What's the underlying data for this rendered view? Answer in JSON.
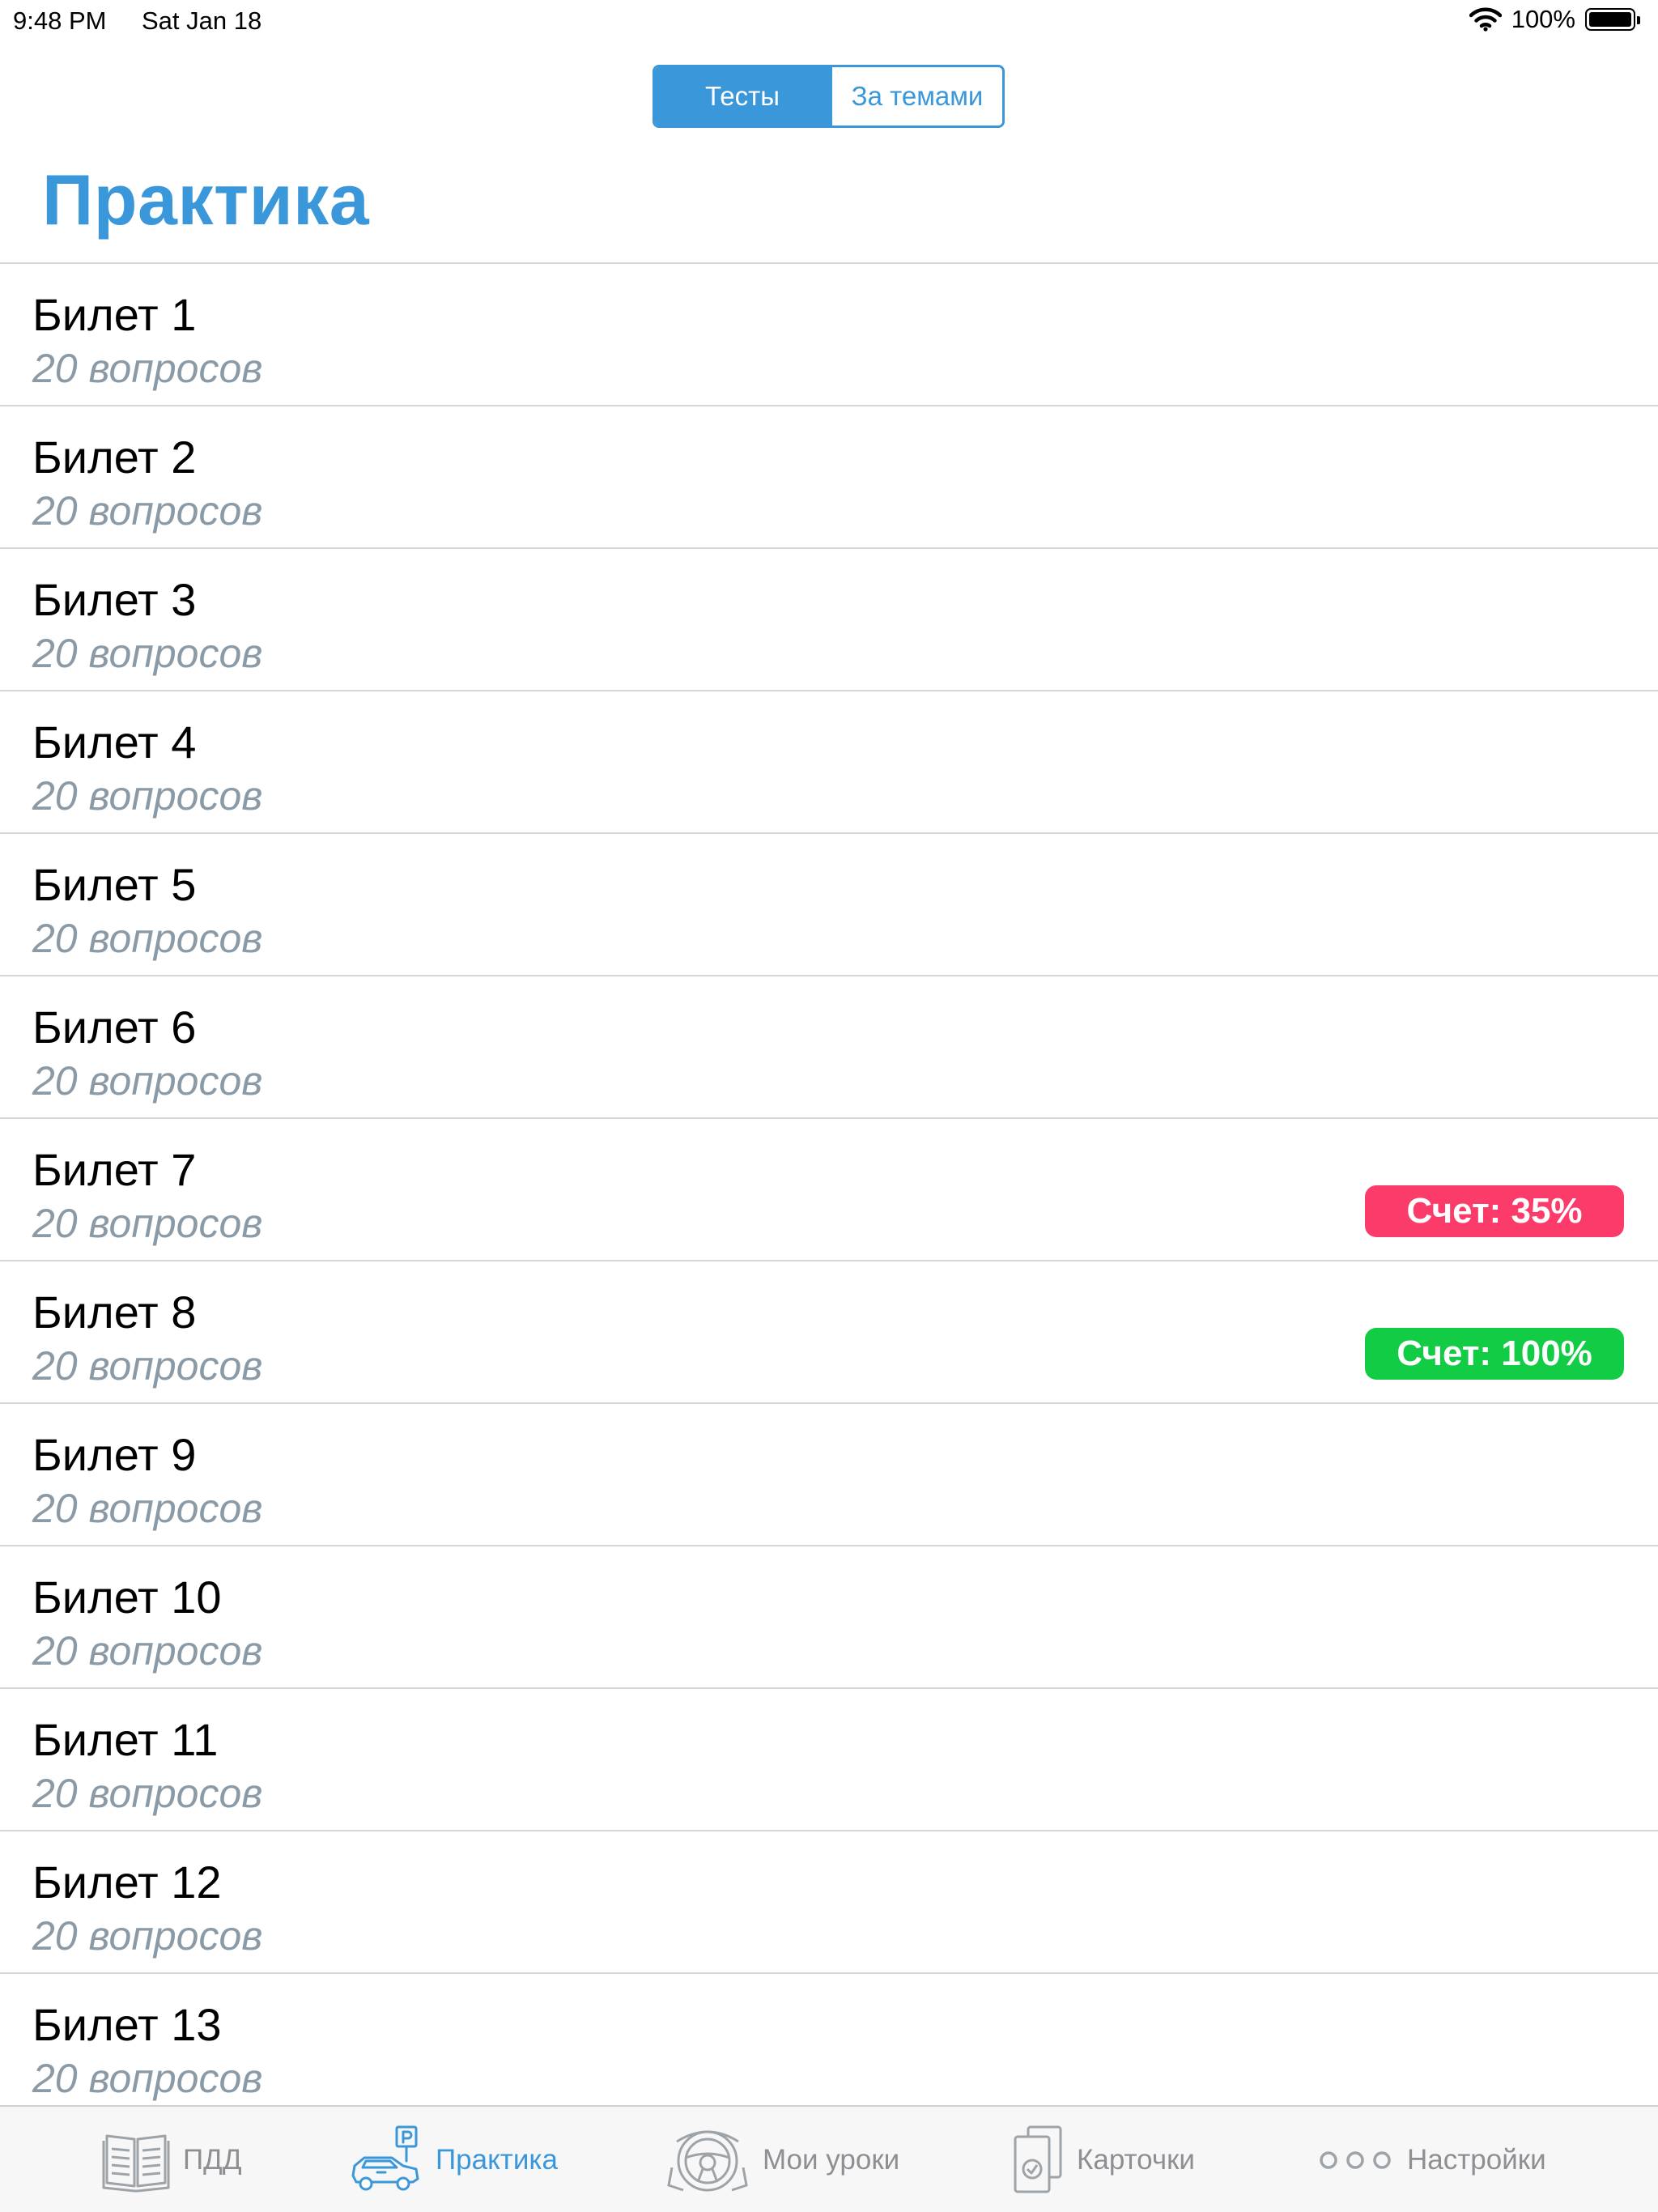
{
  "status": {
    "time": "9:48 PM",
    "date": "Sat Jan 18",
    "battery": "100%"
  },
  "segments": [
    "Тесты",
    "За темами"
  ],
  "title": "Практика",
  "tickets": [
    {
      "title": "Билет 1",
      "subtitle": "20 вопросов"
    },
    {
      "title": "Билет 2",
      "subtitle": "20 вопросов"
    },
    {
      "title": "Билет 3",
      "subtitle": "20 вопросов"
    },
    {
      "title": "Билет 4",
      "subtitle": "20 вопросов"
    },
    {
      "title": "Билет 5",
      "subtitle": "20 вопросов"
    },
    {
      "title": "Билет 6",
      "subtitle": "20 вопросов"
    },
    {
      "title": "Билет 7",
      "subtitle": "20 вопросов",
      "score": "Счет: 35%",
      "score_color": "#fb3c6b"
    },
    {
      "title": "Билет 8",
      "subtitle": "20 вопросов",
      "score": "Счет: 100%",
      "score_color": "#12cc46"
    },
    {
      "title": "Билет 9",
      "subtitle": "20 вопросов"
    },
    {
      "title": "Билет 10",
      "subtitle": "20 вопросов"
    },
    {
      "title": "Билет 11",
      "subtitle": "20 вопросов"
    },
    {
      "title": "Билет 12",
      "subtitle": "20 вопросов"
    },
    {
      "title": "Билет 13",
      "subtitle": "20 вопросов"
    }
  ],
  "tabs": [
    {
      "label": "ПДД",
      "icon": "book-icon"
    },
    {
      "label": "Практика",
      "icon": "car-parking-icon",
      "active": true
    },
    {
      "label": "Мои уроки",
      "icon": "steering-wheel-icon"
    },
    {
      "label": "Карточки",
      "icon": "cards-icon"
    },
    {
      "label": "Настройки",
      "icon": "more-dots-icon"
    }
  ],
  "colors": {
    "accent": "#3a97d9",
    "score_low": "#fb3c6b",
    "score_high": "#12cc46",
    "subtitle": "#8a9aa6"
  }
}
